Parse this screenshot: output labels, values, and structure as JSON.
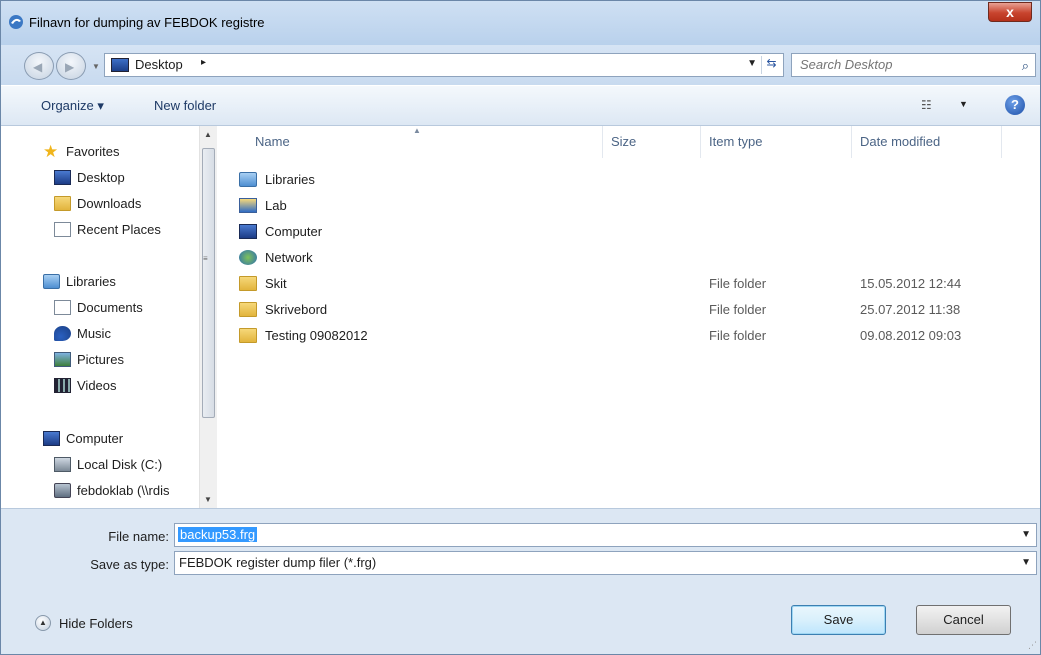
{
  "window": {
    "title": "Filnavn for dumping av FEBDOK registre",
    "close_label": "x"
  },
  "address": {
    "location": "Desktop",
    "chevron": "▸",
    "search_placeholder": "Search Desktop"
  },
  "toolbar": {
    "organize_label": "Organize ▾",
    "new_folder_label": "New folder",
    "help_label": "?"
  },
  "navpane": {
    "items": [
      {
        "label": "Favorites",
        "icon": "star-icon"
      },
      {
        "label": "Desktop",
        "icon": "desktop-icon"
      },
      {
        "label": "Downloads",
        "icon": "downloads-folder-icon"
      },
      {
        "label": "Recent Places",
        "icon": "recent-places-icon"
      },
      {
        "label": "Libraries",
        "icon": "library-icon"
      },
      {
        "label": "Documents",
        "icon": "document-icon"
      },
      {
        "label": "Music",
        "icon": "music-icon"
      },
      {
        "label": "Pictures",
        "icon": "pictures-icon"
      },
      {
        "label": "Videos",
        "icon": "videos-icon"
      },
      {
        "label": "Computer",
        "icon": "computer-icon"
      },
      {
        "label": "Local Disk (C:)",
        "icon": "local-disk-icon"
      },
      {
        "label": "febdoklab (\\\\rdis",
        "icon": "network-drive-icon"
      }
    ]
  },
  "filelist": {
    "columns": [
      "Name",
      "Size",
      "Item type",
      "Date modified"
    ],
    "rows": [
      {
        "name": "Libraries",
        "type": "",
        "date": "",
        "icon": "library-icon"
      },
      {
        "name": "Lab",
        "type": "",
        "date": "",
        "icon": "lab-library-icon"
      },
      {
        "name": "Computer",
        "type": "",
        "date": "",
        "icon": "computer-icon"
      },
      {
        "name": "Network",
        "type": "",
        "date": "",
        "icon": "network-icon"
      },
      {
        "name": "Skit",
        "type": "File folder",
        "date": "15.05.2012 12:44",
        "icon": "folder-icon"
      },
      {
        "name": "Skrivebord",
        "type": "File folder",
        "date": "25.07.2012 11:38",
        "icon": "folder-icon"
      },
      {
        "name": "Testing 09082012",
        "type": "File folder",
        "date": "09.08.2012 09:03",
        "icon": "folder-icon"
      }
    ]
  },
  "form": {
    "filename_label": "File name:",
    "filename_value": "backup53.frg",
    "savetype_label": "Save as type:",
    "savetype_value": "FEBDOK register dump filer (*.frg)",
    "hide_folders_label": "Hide Folders",
    "save_label": "Save",
    "cancel_label": "Cancel"
  },
  "colors": {
    "chrome": "#dce7f3",
    "selection": "#3399ff",
    "header_text": "#4b6485"
  }
}
